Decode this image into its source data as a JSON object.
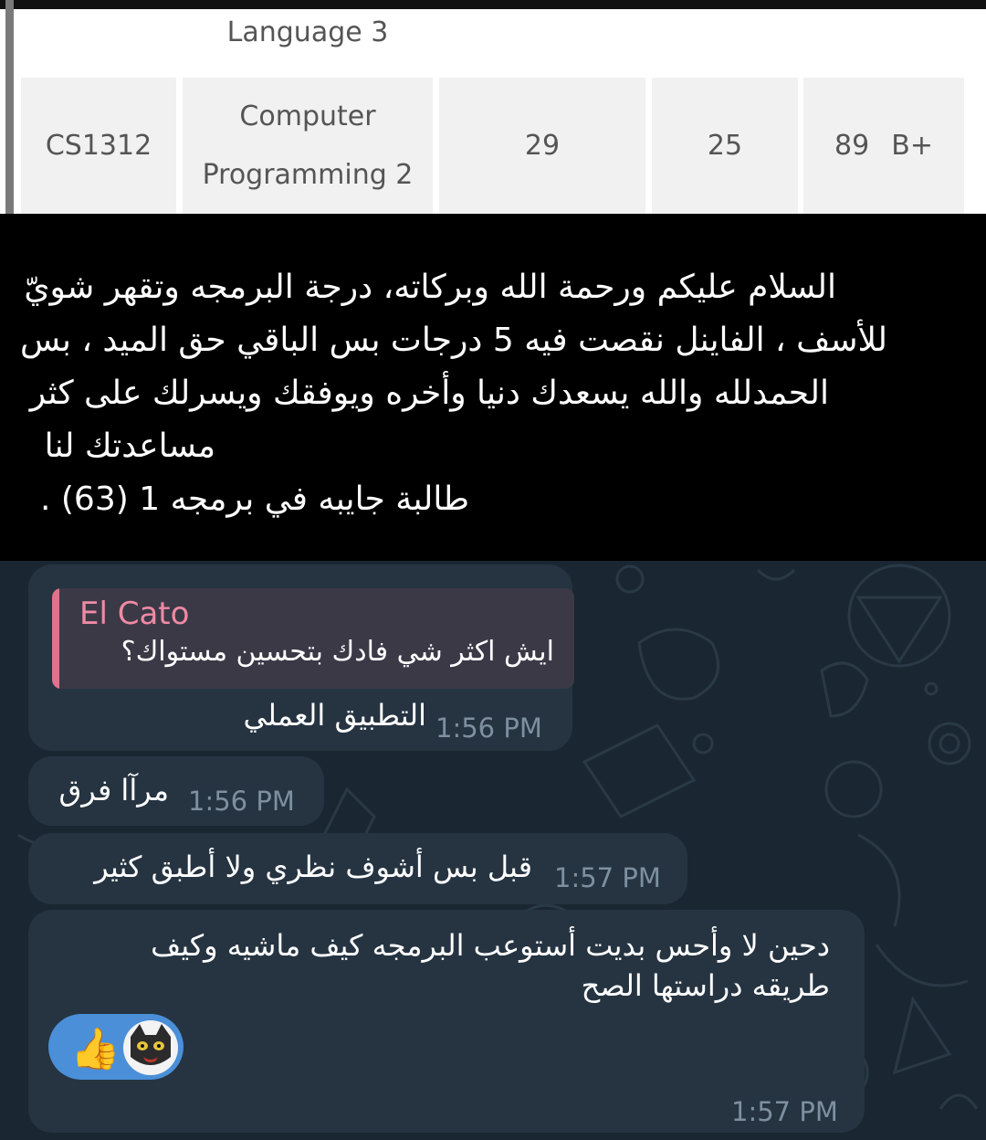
{
  "grades": {
    "prev_course_name": "Language 3",
    "row": {
      "code": "CS1312",
      "name_line1": "Computer",
      "name_line2": "Programming 2",
      "col3": "29",
      "col4": "25",
      "total": "89",
      "letter": "B+"
    }
  },
  "announcement": {
    "lines": [
      "السلام عليكم ورحمة الله وبركاته، درجة البرمجه وتقهر شويّ",
      "للأسف ، الفاينل نقصت فيه 5 درجات بس الباقي حق الميد ، بس",
      "الحمدلله والله يسعدك دنيا وأخره ويوفقك ويسرلك على كثر",
      "مساعدتك لنا",
      "طالبة جايبه في برمجه 1 (63) ."
    ]
  },
  "chat": {
    "messages": [
      {
        "reply_name": "El Cato",
        "reply_text": "ايش اكثر شي فادك بتحسين مستواك؟",
        "text": "التطبيق العملي",
        "time": "1:56 PM"
      },
      {
        "text": "مرآا فرق",
        "time": "1:56 PM"
      },
      {
        "text": "قبل بس أشوف نظري ولا أطبق كثير",
        "time": "1:57 PM"
      },
      {
        "line1": "دحين لا وأحس بديت أستوعب البرمجه كيف ماشيه وكيف",
        "line2": "طريقه دراستها الصح",
        "reactions": [
          "thumbs-up",
          "cat-face"
        ],
        "time": "1:57 PM"
      }
    ]
  },
  "colors": {
    "chat_background": "#1a2732",
    "bubble": "#263442",
    "reply_accent": "#e0728d",
    "reaction_pill": "#4a8fd8"
  }
}
